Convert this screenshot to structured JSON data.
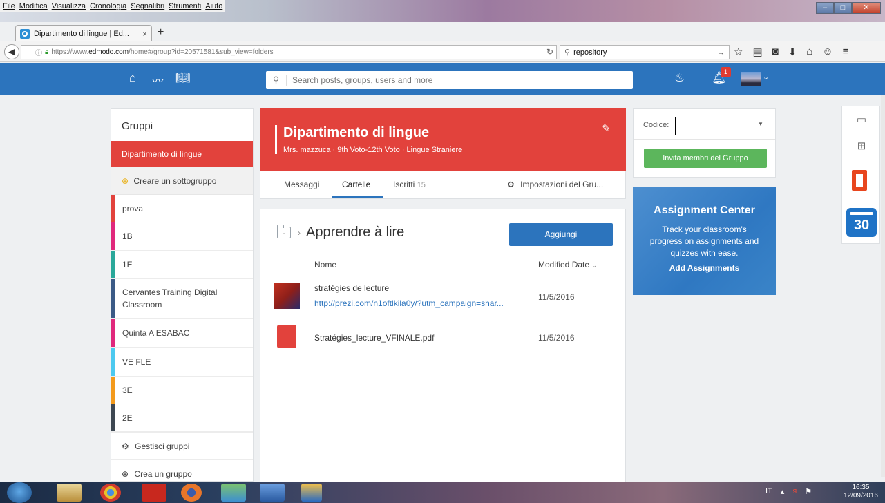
{
  "browser": {
    "menu": [
      "File",
      "Modifica",
      "Visualizza",
      "Cronologia",
      "Segnalibri",
      "Strumenti",
      "Aiuto"
    ],
    "tab_title": "Dipartimento di lingue | Ed...",
    "tab_close": "×",
    "new_tab": "+",
    "url_prefix": "https://www.",
    "url_domain": "edmodo.com",
    "url_suffix": "/home#/group?id=20571581&sub_view=folders",
    "search_value": "repository"
  },
  "header": {
    "search_placeholder": "Search posts, groups, users and more",
    "notifications_count": "1"
  },
  "sidebar": {
    "title": "Gruppi",
    "active_group": "Dipartimento di lingue",
    "create_subgroup": "Creare un sottogruppo",
    "groups": [
      {
        "label": "prova",
        "color": "#e2423c"
      },
      {
        "label": "1B",
        "color": "#e0287c"
      },
      {
        "label": "1E",
        "color": "#2aa89a"
      },
      {
        "label": "Cervantes Training Digital Classroom",
        "color": "#3b5a86"
      },
      {
        "label": "Quinta A ESABAC",
        "color": "#e0287c"
      },
      {
        "label": "VE FLE",
        "color": "#4cc9ef"
      },
      {
        "label": "3E",
        "color": "#f39a1c"
      },
      {
        "label": "2E",
        "color": "#3d4752"
      }
    ],
    "manage_groups": "Gestisci gruppi",
    "create_group": "Crea un gruppo"
  },
  "group": {
    "name": "Dipartimento di lingue",
    "meta": "Mrs. mazzuca · 9th Voto-12th Voto · Lingue Straniere",
    "tabs": {
      "messages": "Messaggi",
      "folders": "Cartelle",
      "members": "Iscritti",
      "members_count": "15",
      "settings": "Impostazioni del Gru..."
    }
  },
  "folder": {
    "title": "Apprendre à lire",
    "add_button": "Aggiungi",
    "col_name": "Nome",
    "col_date": "Modified Date",
    "files": [
      {
        "name": "stratégies de lecture",
        "link": "http://prezi.com/n1oftlkila0y/?utm_campaign=shar...",
        "date": "11/5/2016"
      },
      {
        "name": "Stratégies_lecture_VFINALE.pdf",
        "date": "11/5/2016"
      }
    ]
  },
  "code_panel": {
    "label": "Codice:",
    "invite_button": "Invita membri del Gruppo"
  },
  "assignment_center": {
    "title": "Assignment Center",
    "text": "Track your classroom's progress on assignments and quizzes with ease.",
    "link": "Add Assignments"
  },
  "apps": {
    "calendar_day": "30"
  },
  "taskbar": {
    "language": "IT",
    "time": "16:35",
    "date": "12/09/2016"
  },
  "colors": {
    "edmodo_blue": "#2c74bd",
    "group_red": "#e2423c",
    "invite_green": "#5cb65c"
  }
}
